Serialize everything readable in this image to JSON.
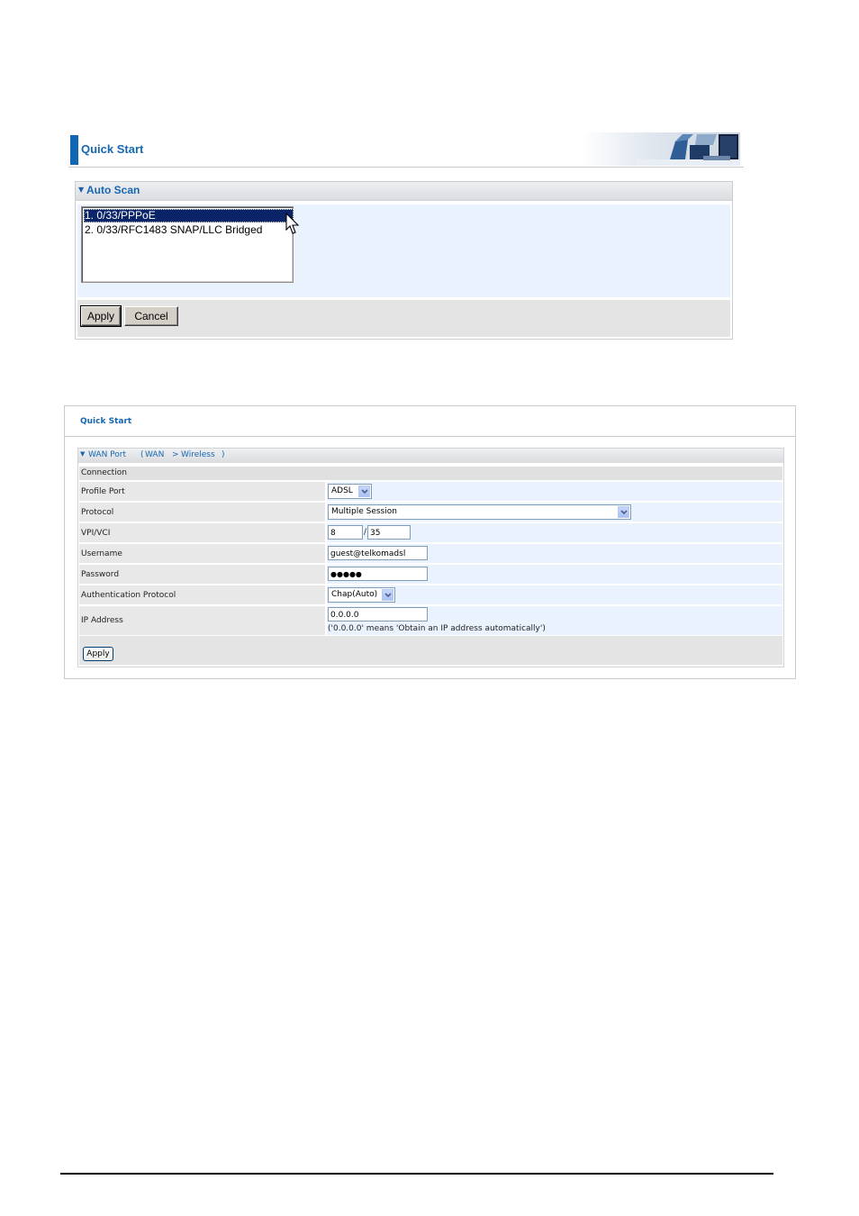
{
  "auto_scan_panel": {
    "header_title": "Quick Start",
    "section_title": "Auto Scan",
    "list_items": [
      "1. 0/33/PPPoE",
      "2. 0/33/RFC1483 SNAP/LLC Bridged"
    ],
    "selected_index": 0,
    "apply_label": "Apply",
    "cancel_label": "Cancel"
  },
  "wan_panel": {
    "header_title": "Quick Start",
    "section": {
      "title": "WAN Port",
      "breadcrumb_open": "(",
      "breadcrumb_current": "WAN",
      "breadcrumb_separator": ">",
      "breadcrumb_next": "Wireless",
      "breadcrumb_close": ")"
    },
    "connection_label": "Connection",
    "fields": {
      "profile_port": {
        "label": "Profile Port",
        "value": "ADSL"
      },
      "protocol": {
        "label": "Protocol",
        "value": "Multiple Session"
      },
      "vpi_vci": {
        "label": "VPI/VCI",
        "vpi": "8",
        "separator": "/",
        "vci": "35"
      },
      "username": {
        "label": "Username",
        "value": "guest@telkomadsl"
      },
      "password": {
        "label": "Password",
        "value": "●●●●●"
      },
      "auth_protocol": {
        "label": "Authentication Protocol",
        "value": "Chap(Auto)"
      },
      "ip_address": {
        "label": "IP Address",
        "value": "0.0.0.0",
        "hint": "('0.0.0.0' means 'Obtain an IP address automatically')"
      }
    },
    "apply_label": "Apply"
  },
  "colors": {
    "accent_blue": "#1167b3",
    "selection_navy": "#0a246a",
    "value_cell_bg": "#eaf3fd"
  }
}
